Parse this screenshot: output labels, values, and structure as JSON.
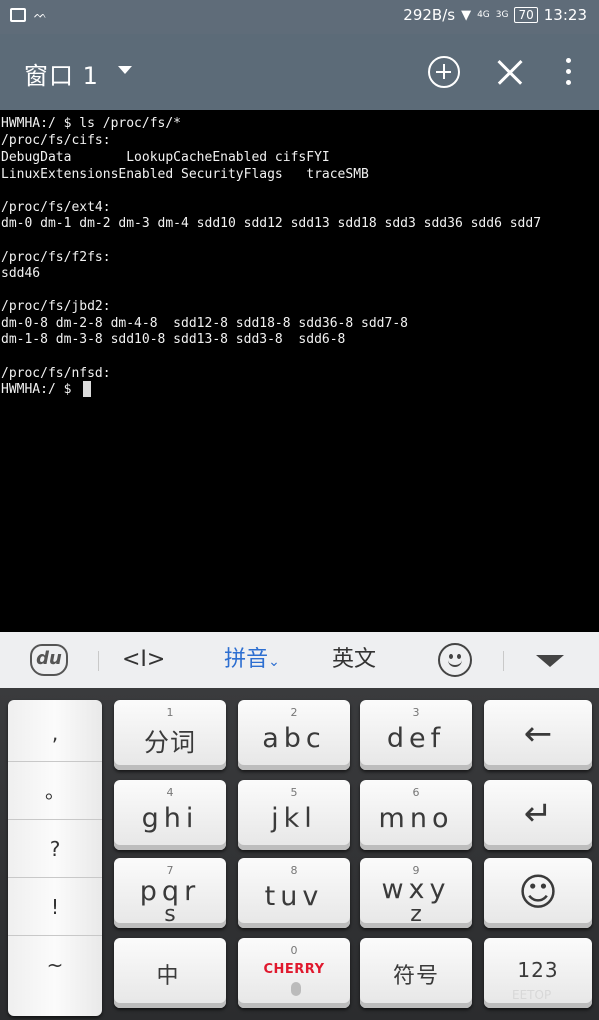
{
  "status_bar": {
    "net_speed": "292B/s",
    "signal_1": "4G",
    "signal_2": "3G",
    "battery": "70",
    "time": "13:23"
  },
  "app_bar": {
    "title": "窗口 1",
    "icons": [
      "chevron-down-icon",
      "add-circle-icon",
      "close-icon",
      "more-vert-icon"
    ]
  },
  "terminal": {
    "lines": [
      "HWMHA:/ $ ls /proc/fs/*",
      "/proc/fs/cifs:",
      "DebugData       LookupCacheEnabled cifsFYI",
      "LinuxExtensionsEnabled SecurityFlags   traceSMB",
      "",
      "/proc/fs/ext4:",
      "dm-0 dm-1 dm-2 dm-3 dm-4 sdd10 sdd12 sdd13 sdd18 sdd3 sdd36 sdd6 sdd7",
      "",
      "/proc/fs/f2fs:",
      "sdd46",
      "",
      "/proc/fs/jbd2:",
      "dm-0-8 dm-2-8 dm-4-8  sdd12-8 sdd18-8 sdd36-8 sdd7-8",
      "dm-1-8 dm-3-8 sdd10-8 sdd13-8 sdd3-8  sdd6-8",
      "",
      "/proc/fs/nfsd:",
      "HWMHA:/ $ "
    ]
  },
  "keyboard_toolbar": {
    "logo": "du",
    "cursor_tool": "<I>",
    "pinyin": "拼音",
    "english": "英文"
  },
  "keyboard": {
    "punctuation": [
      ",",
      "。",
      "?",
      "!",
      "~"
    ],
    "keys": [
      {
        "hint": "1",
        "label": "分词",
        "sub": ""
      },
      {
        "hint": "2",
        "label": "abc",
        "sub": ""
      },
      {
        "hint": "3",
        "label": "def",
        "sub": ""
      },
      {
        "hint": "4",
        "label": "ghi",
        "sub": ""
      },
      {
        "hint": "5",
        "label": "jkl",
        "sub": ""
      },
      {
        "hint": "6",
        "label": "mno",
        "sub": ""
      },
      {
        "hint": "7",
        "label": "pqr",
        "sub": "s"
      },
      {
        "hint": "8",
        "label": "tuv",
        "sub": ""
      },
      {
        "hint": "9",
        "label": "wxy",
        "sub": "z"
      }
    ],
    "zhong": "中",
    "space_hint": "0",
    "space_brand": "CHERRY",
    "symbols": "符号",
    "num": "123",
    "backspace": "←",
    "enter": "↵",
    "emoji": "☺"
  },
  "watermark": "EETOP"
}
